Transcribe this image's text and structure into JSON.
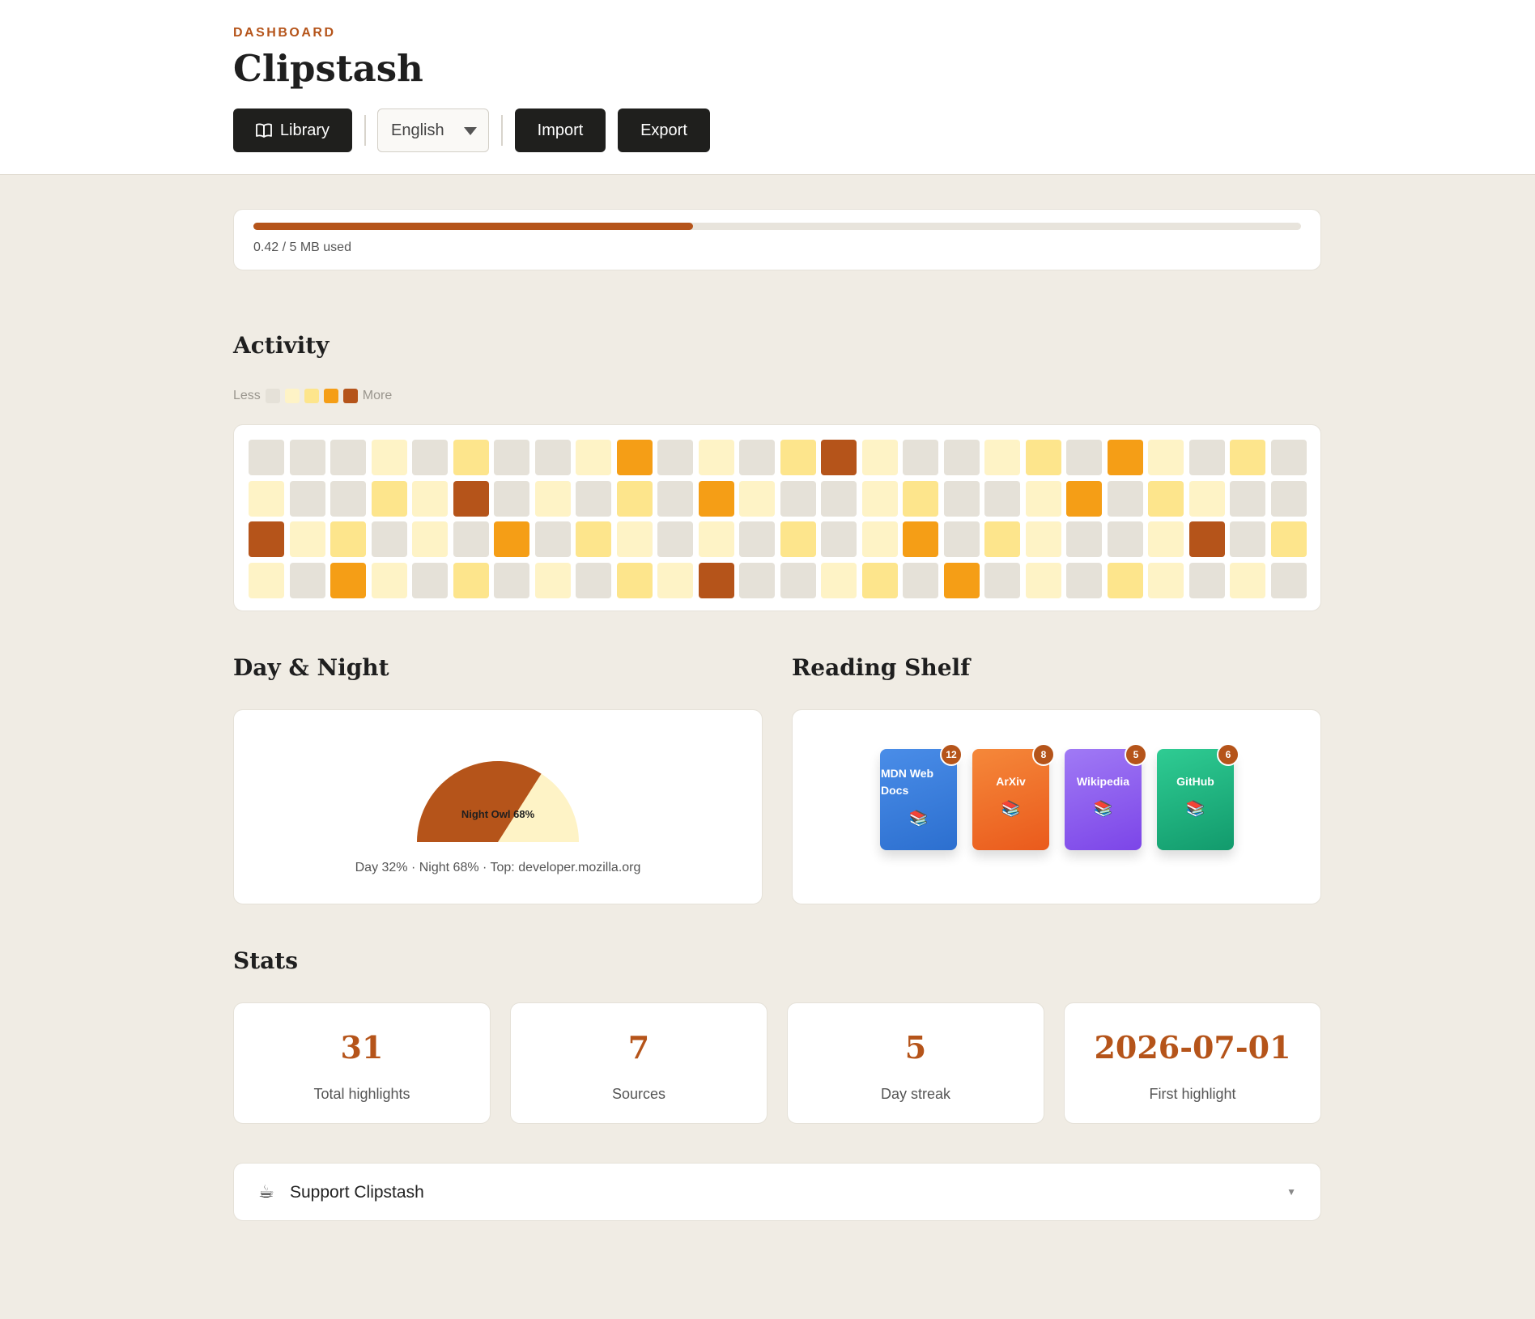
{
  "header": {
    "eyebrow": "DASHBOARD",
    "title": "Clipstash",
    "library_label": "Library",
    "language": "English",
    "import_label": "Import",
    "export_label": "Export"
  },
  "storage": {
    "used_text": "0.42 / 5 MB used",
    "used_fraction": 0.42
  },
  "activity": {
    "heading": "Activity",
    "legend_less": "Less",
    "legend_more": "More",
    "legend_colors": [
      "#e5e1d8",
      "#fef3c6",
      "#fde58c",
      "#f59e16",
      "#b5541a"
    ],
    "levels": [
      [
        0,
        0,
        0,
        1,
        0,
        2,
        0,
        0,
        1,
        3,
        0,
        1,
        0,
        2,
        4,
        1,
        0,
        0,
        1,
        2,
        0,
        3,
        1,
        0,
        2,
        0
      ],
      [
        1,
        0,
        0,
        2,
        1,
        4,
        0,
        1,
        0,
        2,
        0,
        3,
        1,
        0,
        0,
        1,
        2,
        0,
        0,
        1,
        3,
        0,
        2,
        1,
        0,
        0
      ],
      [
        4,
        1,
        2,
        0,
        1,
        0,
        3,
        0,
        2,
        1,
        0,
        1,
        0,
        2,
        0,
        1,
        3,
        0,
        2,
        1,
        0,
        0,
        1,
        4,
        0,
        2
      ],
      [
        1,
        0,
        3,
        1,
        0,
        2,
        0,
        1,
        0,
        2,
        1,
        4,
        0,
        0,
        1,
        2,
        0,
        3,
        0,
        1,
        0,
        2,
        1,
        0,
        1,
        0
      ]
    ]
  },
  "day_night": {
    "heading": "Day & Night",
    "day_percent": 32,
    "night_percent": 68,
    "chart_label": "Night Owl 68%",
    "caption": "Day 32% · Night 68% · Top: developer.mozilla.org",
    "night_color": "#b5541a",
    "day_color": "#fef3c6"
  },
  "shelf": {
    "heading": "Reading Shelf",
    "books": [
      {
        "name": "MDN Web Docs",
        "count": "12",
        "icon": "books-icon",
        "color_from": "#4a8de8",
        "color_to": "#2c6fcf"
      },
      {
        "name": "ArXiv",
        "count": "8",
        "icon": "books-icon",
        "color_from": "#f5883a",
        "color_to": "#ea5a1c"
      },
      {
        "name": "Wikipedia",
        "count": "5",
        "icon": "books-icon",
        "color_from": "#a07af5",
        "color_to": "#7c45e8"
      },
      {
        "name": "GitHub",
        "count": "6",
        "icon": "books-icon",
        "color_from": "#2fcc93",
        "color_to": "#129a6c"
      }
    ]
  },
  "stats": {
    "heading": "Stats",
    "items": [
      {
        "value": "31",
        "label": "Total highlights"
      },
      {
        "value": "7",
        "label": "Sources"
      },
      {
        "value": "5",
        "label": "Day streak"
      },
      {
        "value": "2026-07-01",
        "label": "First highlight"
      }
    ]
  },
  "support": {
    "icon": "coffee-icon",
    "label": "Support Clipstash"
  }
}
